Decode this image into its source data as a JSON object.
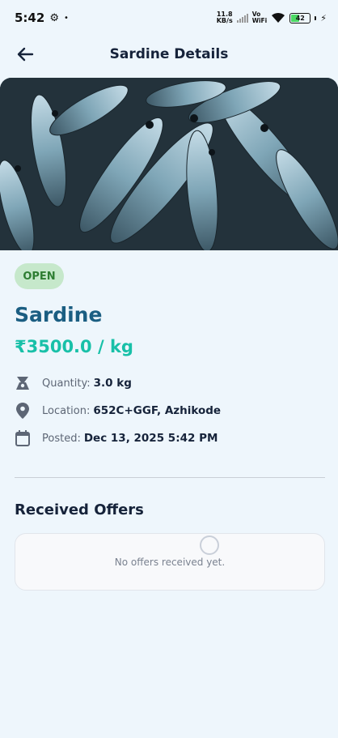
{
  "status_bar": {
    "time": "5:42",
    "speed_value": "11.8",
    "speed_unit": "KB/s",
    "vo_label": "Vo",
    "wifi_label": "WiFi",
    "battery_level": "42"
  },
  "app_bar": {
    "title": "Sardine Details",
    "back_icon": "arrow-left-icon"
  },
  "listing": {
    "status": "OPEN",
    "name": "Sardine",
    "price": "₹3500.0 / kg",
    "quantity_label": "Quantity:",
    "quantity_value": "3.0 kg",
    "location_label": "Location:",
    "location_value": "652C+GGF, Azhikode",
    "posted_label": "Posted:",
    "posted_value": "Dec 13, 2025 5:42 PM"
  },
  "offers": {
    "title": "Received Offers",
    "empty_message": "No offers received yet."
  },
  "colors": {
    "background": "#eef6fc",
    "name": "#1b5e82",
    "price": "#18c0a8",
    "badge_bg": "#c6e8cb",
    "badge_text": "#2e7d32"
  }
}
